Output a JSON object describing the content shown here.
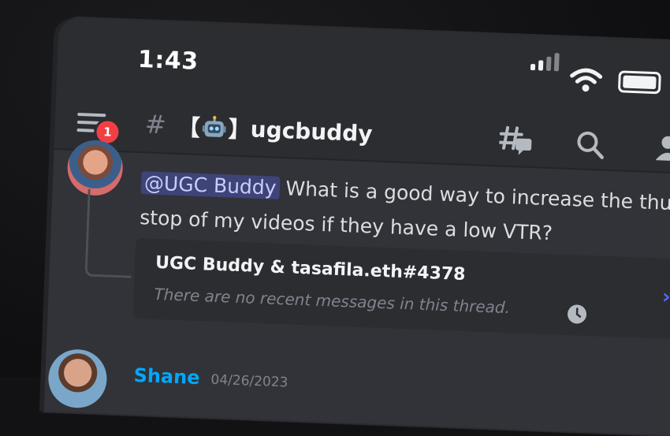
{
  "status_bar": {
    "time": "1:43",
    "signal_icon": "cellular-signal-icon",
    "wifi_icon": "wifi-icon",
    "battery_icon": "battery-icon"
  },
  "header": {
    "menu_icon": "hamburger-menu-icon",
    "notification_count": "1",
    "channel_prefix": "#",
    "channel_bracket_open": "【",
    "channel_emoji_icon": "robot-icon",
    "channel_bracket_close": "】",
    "channel_name": "ugcbuddy",
    "threads_icon": "threads-icon",
    "search_icon": "search-icon",
    "members_icon": "members-icon"
  },
  "message": {
    "mention": "@UGC Buddy",
    "text": " What is a good way to increase the thumb stop of my videos if they have a low VTR?"
  },
  "thread": {
    "title": "UGC Buddy & tasafila.eth#4378",
    "subtitle": "There are no recent messages in this thread.",
    "clock_icon": "clock-icon",
    "chevron_icon": "chevron-right-icon"
  },
  "next_message": {
    "author": "Shane",
    "date": "04/26/2023"
  },
  "colors": {
    "background": "#313338",
    "header": "#2b2d31",
    "mention_bg": "#5865f2",
    "badge": "#f23f43",
    "author_link": "#00a8fc"
  }
}
